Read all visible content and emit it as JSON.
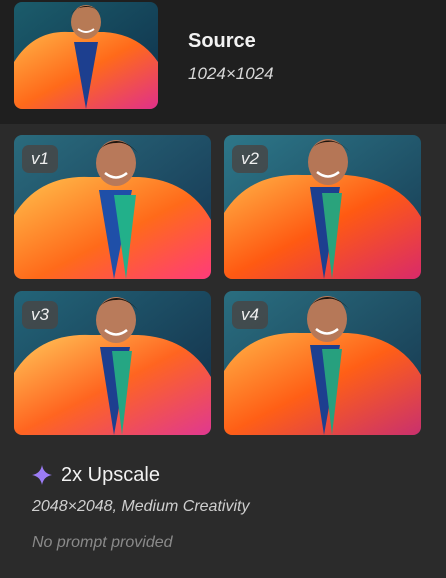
{
  "source": {
    "title": "Source",
    "dimensions": "1024×1024"
  },
  "variations": [
    {
      "label": "v1"
    },
    {
      "label": "v2"
    },
    {
      "label": "v3"
    },
    {
      "label": "v4"
    }
  ],
  "upscale": {
    "icon": "sparkle-icon",
    "title": "2x Upscale",
    "details": "2048×2048, Medium Creativity",
    "prompt": "No prompt provided"
  },
  "colors": {
    "accent": "#9b7cf4",
    "jacket": "#ff6a1a",
    "background": "#2b2b2b"
  }
}
